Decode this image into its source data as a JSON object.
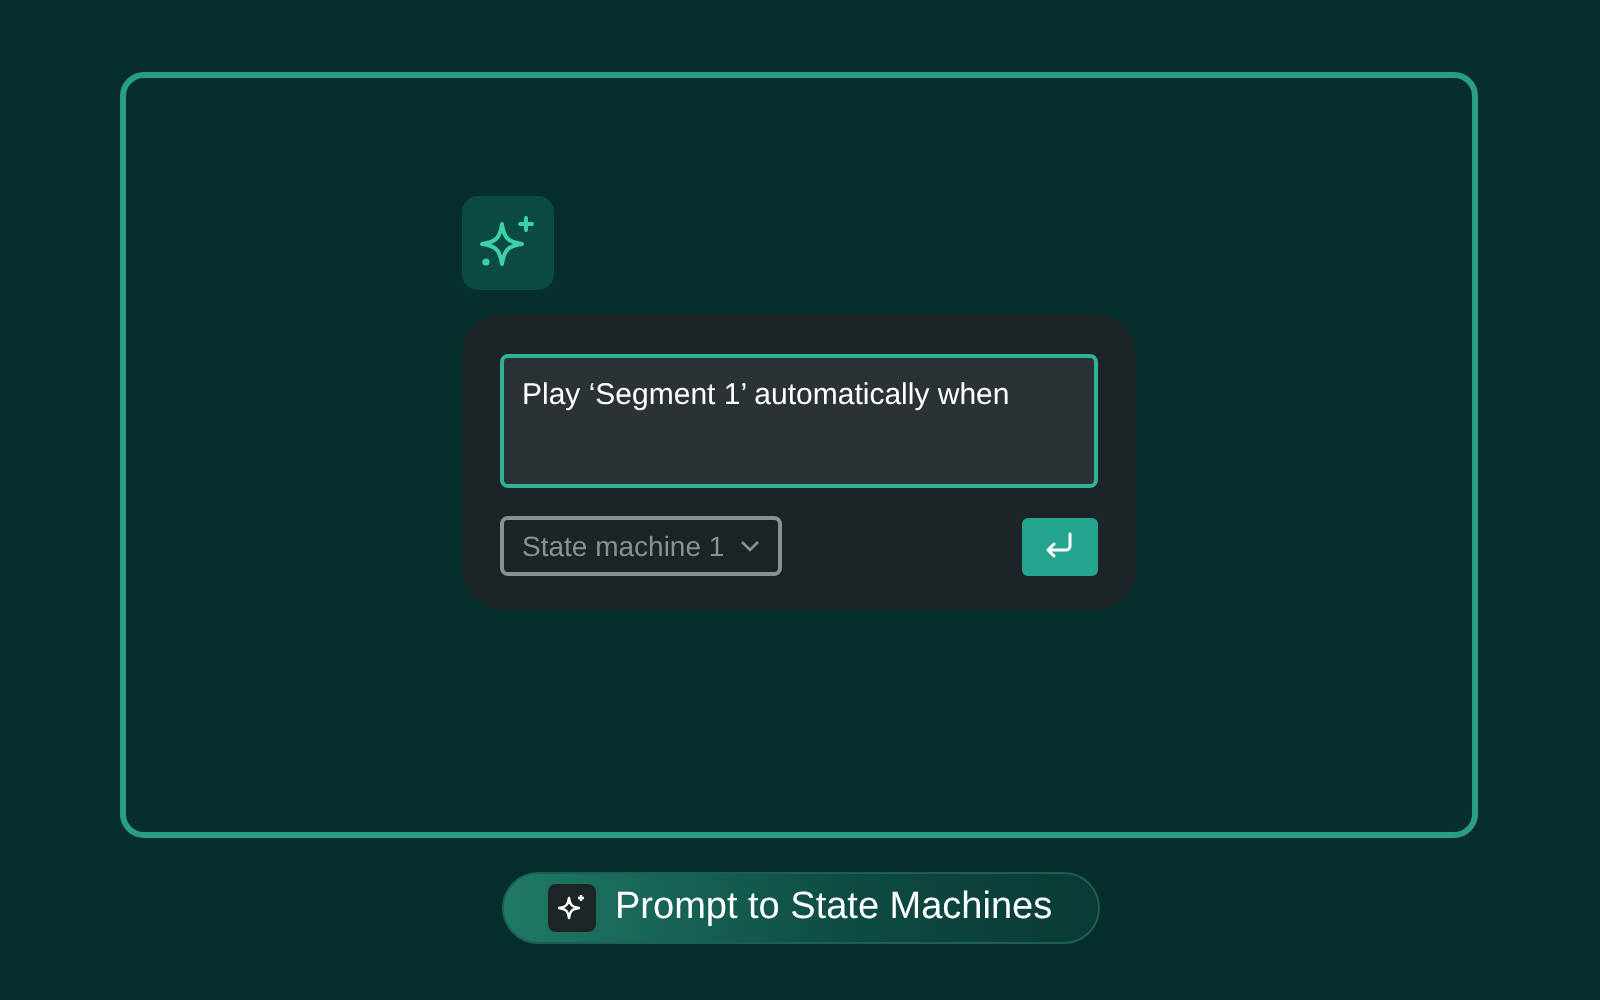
{
  "prompt": {
    "value": "Play ‘Segment 1’ automatically when"
  },
  "dropdown": {
    "label": "State machine 1"
  },
  "banner": {
    "label": "Prompt to State Machines"
  }
}
